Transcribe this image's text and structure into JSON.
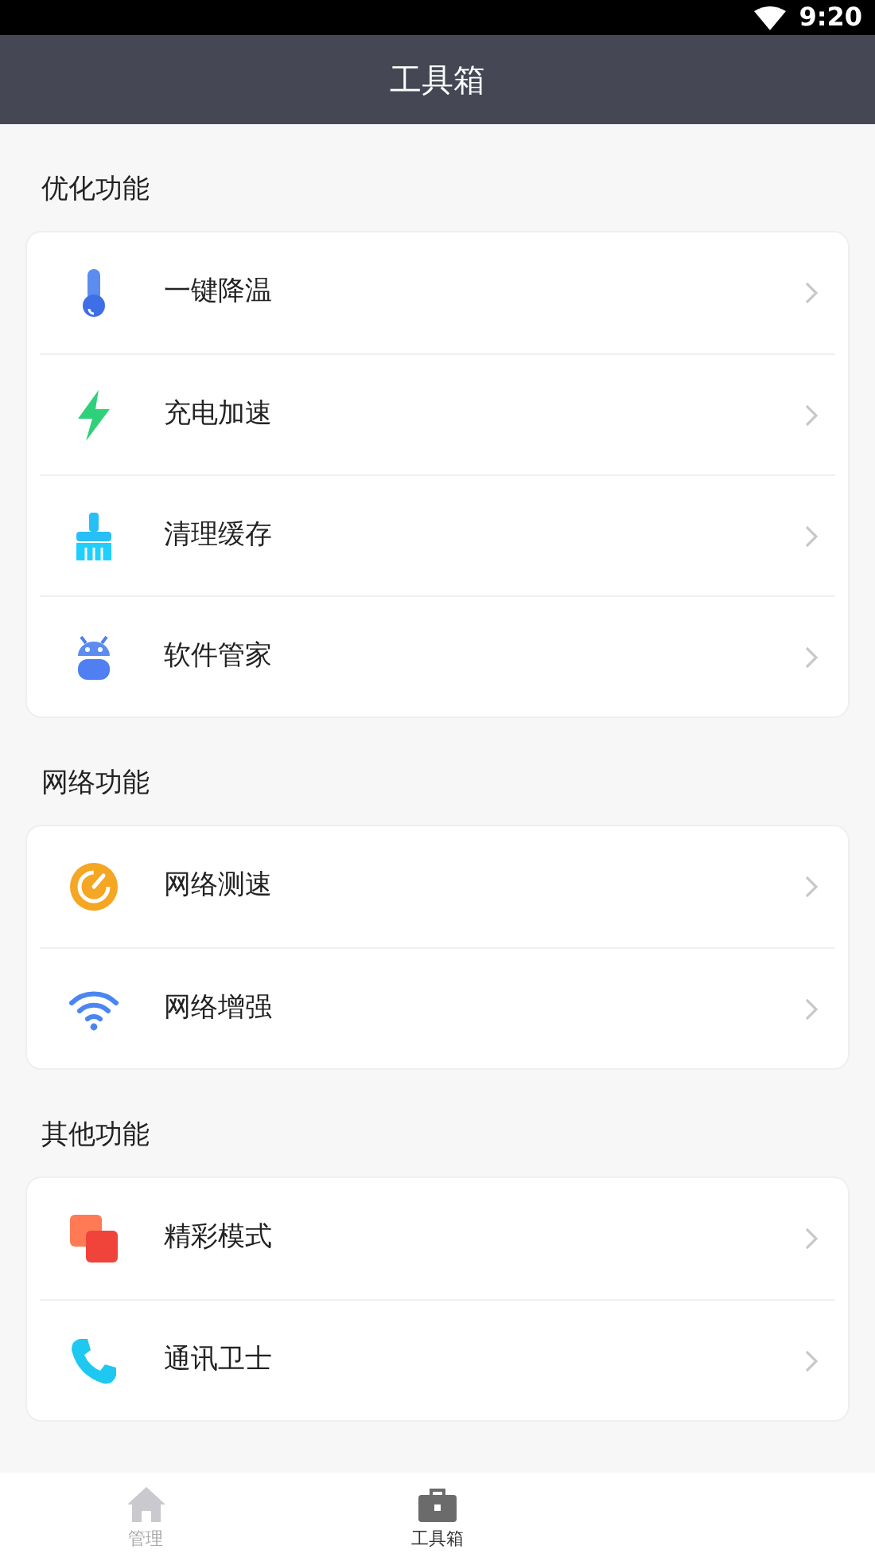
{
  "status_bar": {
    "time": "9:20"
  },
  "header": {
    "title": "工具箱"
  },
  "sections": [
    {
      "title": "优化功能",
      "items": [
        {
          "label": "一键降温",
          "kind": "thermometer"
        },
        {
          "label": "充电加速",
          "kind": "bolt"
        },
        {
          "label": "清理缓存",
          "kind": "broom"
        },
        {
          "label": "软件管家",
          "kind": "robot"
        }
      ]
    },
    {
      "title": "网络功能",
      "items": [
        {
          "label": "网络测速",
          "kind": "gauge"
        },
        {
          "label": "网络增强",
          "kind": "wifi"
        }
      ]
    },
    {
      "title": "其他功能",
      "items": [
        {
          "label": "精彩模式",
          "kind": "squares"
        },
        {
          "label": "通讯卫士",
          "kind": "phone"
        }
      ]
    }
  ],
  "tabs": [
    {
      "label": "管理",
      "kind": "home",
      "selected": false
    },
    {
      "label": "工具箱",
      "kind": "toolbox",
      "selected": true
    }
  ]
}
